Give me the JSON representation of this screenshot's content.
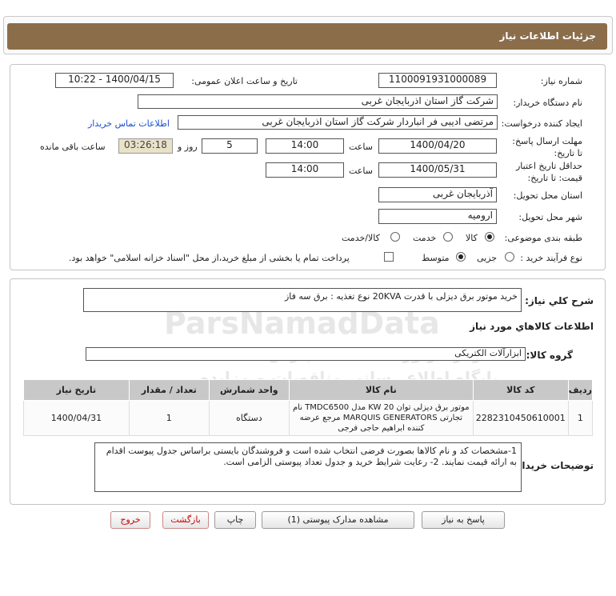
{
  "header": {
    "title": "جزئیات اطلاعات نیاز"
  },
  "form": {
    "need_number_label": "شماره نیاز:",
    "need_number": "1100091931000089",
    "announce_label": "تاریخ و ساعت اعلان عمومی:",
    "announce_value": "1400/04/15 - 10:22",
    "buyer_org_label": "نام دستگاه خریدار:",
    "buyer_org": "شرکت گاز استان اذربایجان غربی",
    "requester_label": "ایجاد کننده درخواست:",
    "requester": "مرتضی ادیبی فر انباردار شرکت گاز استان اذربایجان غربی",
    "contact_link": "اطلاعات تماس خریدار",
    "reply_deadline_label": "مهلت ارسال پاسخ: تا تاریخ:",
    "reply_date": "1400/04/20",
    "time_label": "ساعت",
    "reply_time": "14:00",
    "days_value": "5",
    "days_label": "روز و",
    "remaining_time": "03:26:18",
    "remaining_label": "ساعت باقی مانده",
    "validity_label": "حداقل تاریخ اعتبار قیمت: تا تاریخ:",
    "validity_date": "1400/05/31",
    "validity_time": "14:00",
    "province_label": "استان محل تحویل:",
    "province": "آذربایجان غربی",
    "city_label": "شهر محل تحویل:",
    "city": "ارومیه",
    "category_label": "طبقه بندی موضوعی:",
    "category_options": [
      "کالا",
      "خدمت",
      "کالا/خدمت"
    ],
    "process_label": "نوع فرآیند خرید :",
    "process_options": [
      "جزیی",
      "متوسط"
    ],
    "payment_note": "پرداخت تمام یا بخشی از مبلغ خرید،از محل \"اسناد خزانه اسلامی\" خواهد بود."
  },
  "summary": {
    "label": "شرح کلي نياز:",
    "value": "خرید  موتور برق دیزلی با قدرت 20KVA نوع تغذیه : برق سه فاز"
  },
  "goods": {
    "section_title": "اطلاعات کالاهاي مورد نياز",
    "group_label": "گروه کالا:",
    "group_value": "ابزارآلات الکتریکی",
    "columns": [
      "ردیف",
      "کد کالا",
      "نام کالا",
      "واحد شمارش",
      "تعداد / مقدار",
      "تاریخ نیاز"
    ],
    "rows": [
      {
        "index": "1",
        "code": "2282310450610001",
        "name": "موتور برق دیزلی توان 20 KW مدل TMDC6500 نام تجارتی MARQUIS GENERATORS مرجع عرضه کننده ابراهیم حاجی فرجی",
        "unit": "دستگاه",
        "qty": "1",
        "date": "1400/04/31"
      }
    ]
  },
  "buyer_notes": {
    "label": "توضیحات خریدار:",
    "text": "1-مشخصات کد و نام کالاها بصورت فرضی انتخاب شده است و فروشندگان بایستی براساس جدول پیوست اقدام به ارائه قیمت نمایند. 2- رعایت شرایط خرید و جدول تعداد پیوستی الزامی است."
  },
  "buttons": {
    "reply": "پاسخ به نیاز",
    "attachments": "مشاهده مدارک پیوستی (1)",
    "print": "چاپ",
    "back": "بازگشت",
    "exit": "خروج"
  },
  "watermark": {
    "brand": "ParsNamadData",
    "line1": "پایگاه اطلاع رسانی مناقصات و مزایده",
    "line2": "مرکز فراوری اطلاعات پارس نماد داده ها"
  }
}
